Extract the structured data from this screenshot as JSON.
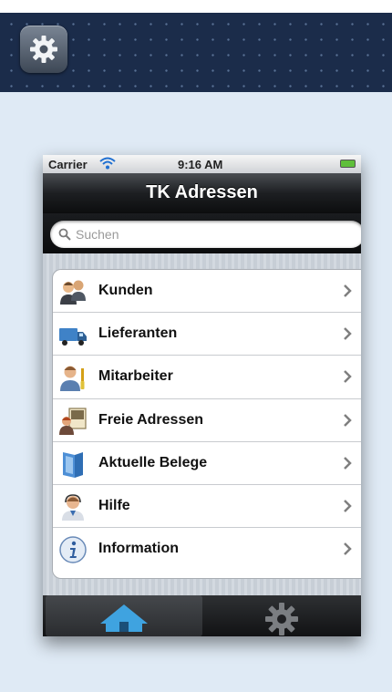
{
  "statusbar": {
    "carrier": "Carrier",
    "time": "9:16 AM"
  },
  "navbar": {
    "title": "TK Adressen"
  },
  "search": {
    "placeholder": "Suchen"
  },
  "menu": {
    "items": [
      {
        "label": "Kunden",
        "icon": "customers-icon"
      },
      {
        "label": "Lieferanten",
        "icon": "truck-icon"
      },
      {
        "label": "Mitarbeiter",
        "icon": "employee-icon"
      },
      {
        "label": "Freie Adressen",
        "icon": "address-card-icon"
      },
      {
        "label": "Aktuelle Belege",
        "icon": "document-folder-icon"
      },
      {
        "label": "Hilfe",
        "icon": "support-person-icon"
      },
      {
        "label": "Information",
        "icon": "info-icon"
      }
    ]
  },
  "tabbar": {
    "tabs": [
      {
        "name": "home",
        "icon": "home-icon",
        "selected": true
      },
      {
        "name": "settings",
        "icon": "gear-icon",
        "selected": false
      }
    ]
  },
  "colors": {
    "banner": "#1b2c4a",
    "panel": "#dfeaf5",
    "navbar": "#1d1f22",
    "home_tab_accent": "#3fa3e0"
  }
}
